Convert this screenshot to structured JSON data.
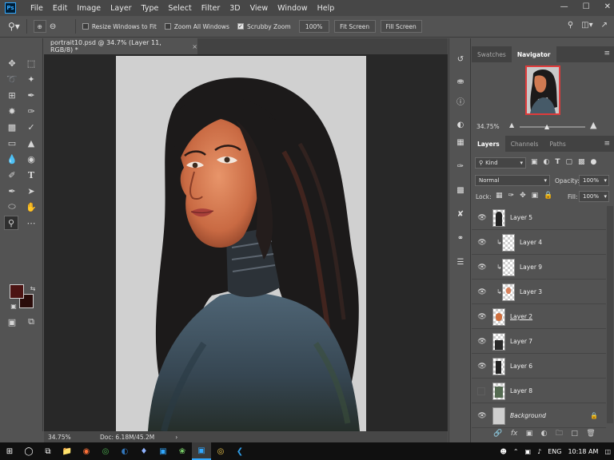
{
  "app": {
    "logo": "Ps"
  },
  "menu": [
    "File",
    "Edit",
    "Image",
    "Layer",
    "Type",
    "Select",
    "Filter",
    "3D",
    "View",
    "Window",
    "Help"
  ],
  "window_controls": {
    "minimize": "—",
    "maximize": "☐",
    "close": "✕"
  },
  "options": {
    "resize_windows_label": "Resize Windows to Fit",
    "resize_windows_checked": false,
    "zoom_all_label": "Zoom All Windows",
    "zoom_all_checked": false,
    "scrubby_zoom_label": "Scrubby Zoom",
    "scrubby_zoom_checked": true,
    "zoom_value": "100%",
    "fit_screen": "Fit Screen",
    "fill_screen": "Fill Screen"
  },
  "document": {
    "tab_title": "portrait10.psd @ 34.7% (Layer 11, RGB/8) *",
    "close": "×"
  },
  "status": {
    "zoom": "34.75%",
    "doc": "Doc: 6.18M/45.2M",
    "arrow": "›"
  },
  "colors": {
    "foreground": "#4c1413",
    "background": "#2a0c0a",
    "accent": "#31a8ff"
  },
  "navigator": {
    "tabs": [
      "Swatches",
      "Navigator"
    ],
    "active_tab": "Navigator",
    "zoom": "34.75%"
  },
  "layers_panel": {
    "tabs": [
      "Layers",
      "Channels",
      "Paths"
    ],
    "active_tab": "Layers",
    "filter_kind": "Kind",
    "blend_mode": "Normal",
    "opacity_label": "Opacity:",
    "opacity_value": "100%",
    "lock_label": "Lock:",
    "fill_label": "Fill:",
    "fill_value": "100%",
    "layers": [
      {
        "name": "Layer 5",
        "visible": true,
        "clipped": false,
        "thumb": "figure-icon"
      },
      {
        "name": "Layer 4",
        "visible": true,
        "clipped": true,
        "thumb": "transparent"
      },
      {
        "name": "Layer 9",
        "visible": true,
        "clipped": true,
        "thumb": "transparent"
      },
      {
        "name": "Layer 3",
        "visible": true,
        "clipped": true,
        "thumb": "skin-icon"
      },
      {
        "name": "Layer 2",
        "visible": true,
        "clipped": false,
        "thumb": "skin-icon"
      },
      {
        "name": "Layer 7",
        "visible": true,
        "clipped": false,
        "thumb": "figure-icon"
      },
      {
        "name": "Layer 6",
        "visible": true,
        "clipped": false,
        "thumb": "figure-icon"
      },
      {
        "name": "Layer 8",
        "visible": false,
        "clipped": false,
        "thumb": "figure-icon"
      },
      {
        "name": "Background",
        "visible": true,
        "clipped": false,
        "thumb": "gray"
      }
    ]
  },
  "taskbar": {
    "time": "10:18 AM",
    "keyboard": "ENG"
  }
}
